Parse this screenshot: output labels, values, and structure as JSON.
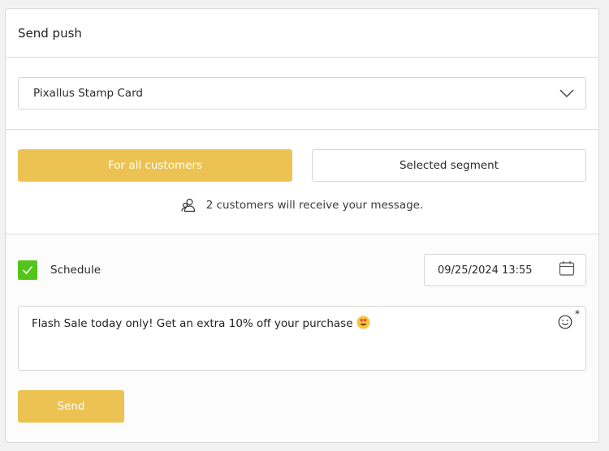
{
  "header": {
    "title": "Send push"
  },
  "card_select": {
    "value": "Pixallus Stamp Card",
    "icon": "chevron-down-icon"
  },
  "audience": {
    "all_label": "For all customers",
    "segment_label": "Selected segment",
    "info_text": "2 customers will receive your message.",
    "info_icon": "users-icon"
  },
  "schedule": {
    "checked": true,
    "label": "Schedule",
    "datetime": "09/25/2024 13:55",
    "calendar_icon": "calendar-icon"
  },
  "message": {
    "text": "Flash Sale today only! Get an extra 10% off your purchase",
    "emoji": "heart-eyes-emoji",
    "emoji_picker_icon": "smile-icon",
    "required_mark": "*"
  },
  "send_label": "Send",
  "colors": {
    "accent": "#ecc352",
    "check": "#52c41a",
    "border": "#d5d5d5"
  }
}
